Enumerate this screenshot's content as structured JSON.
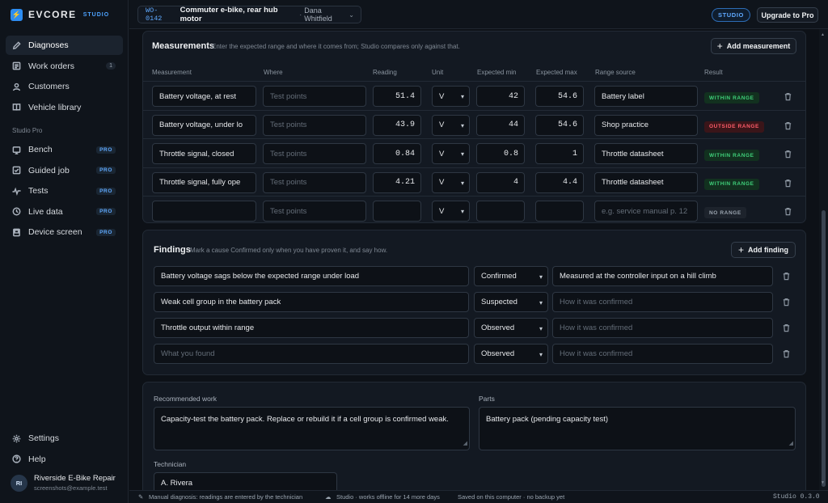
{
  "app": {
    "brand": "EVCORE",
    "brand_sub": "STUDIO",
    "studio_badge": "STUDIO",
    "upgrade_label": "Upgrade to Pro"
  },
  "work_order": {
    "id": "WO-0142",
    "title": "Commuter e-bike, rear hub motor",
    "separator": "·",
    "customer": "Dana Whitfield"
  },
  "sidebar": {
    "items": [
      {
        "label": "Diagnoses",
        "icon": "pencil-icon",
        "active": true
      },
      {
        "label": "Work orders",
        "icon": "list-icon",
        "count": "1"
      },
      {
        "label": "Customers",
        "icon": "person-icon"
      },
      {
        "label": "Vehicle library",
        "icon": "book-icon"
      }
    ],
    "section_label": "Studio Pro",
    "pro_items": [
      {
        "label": "Bench",
        "icon": "gauge-icon",
        "tag": "PRO"
      },
      {
        "label": "Guided job",
        "icon": "checklist-icon",
        "tag": "PRO"
      },
      {
        "label": "Tests",
        "icon": "pulse-icon",
        "tag": "PRO"
      },
      {
        "label": "Live data",
        "icon": "clock-icon",
        "tag": "PRO"
      },
      {
        "label": "Device screen",
        "icon": "device-icon",
        "tag": "PRO"
      }
    ],
    "bottom": [
      {
        "label": "Settings",
        "icon": "gear-icon"
      },
      {
        "label": "Help",
        "icon": "help-icon"
      }
    ],
    "user": {
      "initials": "RI",
      "name": "Riverside E-Bike Repair",
      "email": "screenshots@example.test"
    }
  },
  "measurements": {
    "title": "Measurements",
    "hint": "Enter the expected range and where it comes from; Studio compares only against that.",
    "add_label": "Add measurement",
    "columns": [
      "Measurement",
      "Where",
      "Reading",
      "Unit",
      "Expected min",
      "Expected max",
      "Range source",
      "Result"
    ],
    "rows": [
      {
        "name": "Battery voltage, at rest",
        "where": "Test points",
        "reading": "51.4",
        "unit": "V",
        "min": "42",
        "max": "54.6",
        "source": "Battery label",
        "result": "WITHIN RANGE",
        "status": "in"
      },
      {
        "name": "Battery voltage, under lo",
        "where": "Test points",
        "reading": "43.9",
        "unit": "V",
        "min": "44",
        "max": "54.6",
        "source": "Shop practice",
        "result": "OUTSIDE RANGE",
        "status": "out"
      },
      {
        "name": "Throttle signal, closed",
        "where": "Test points",
        "reading": "0.84",
        "unit": "V",
        "min": "0.8",
        "max": "1",
        "source": "Throttle datasheet",
        "result": "WITHIN RANGE",
        "status": "in"
      },
      {
        "name": "Throttle signal, fully ope",
        "where": "Test points",
        "reading": "4.21",
        "unit": "V",
        "min": "4",
        "max": "4.4",
        "source": "Throttle datasheet",
        "result": "WITHIN RANGE",
        "status": "in"
      },
      {
        "name": "",
        "where": "Test points",
        "reading": "",
        "unit": "V",
        "min": "",
        "max": "",
        "source": "e.g. service manual p. 12",
        "result": "NO RANGE",
        "status": "none"
      }
    ]
  },
  "findings": {
    "title": "Findings",
    "hint": "Mark a cause Confirmed only when you have proven it, and say how.",
    "add_label": "Add finding",
    "rows": [
      {
        "text": "Battery voltage sags below the expected range under load",
        "status": "Confirmed",
        "how": "Measured at the controller input on a hill climb",
        "how_placeholder": false
      },
      {
        "text": "Weak cell group in the battery pack",
        "status": "Suspected",
        "how": "How it was confirmed",
        "how_placeholder": true
      },
      {
        "text": "Throttle output within range",
        "status": "Observed",
        "how": "How it was confirmed",
        "how_placeholder": true
      },
      {
        "text": "What you found",
        "text_placeholder": true,
        "status": "Observed",
        "how": "How it was confirmed",
        "how_placeholder": true
      }
    ]
  },
  "recommendation": {
    "work_label": "Recommended work",
    "work_value": "Capacity-test the battery pack. Replace or rebuild it if a cell group is confirmed weak.",
    "parts_label": "Parts",
    "parts_value": "Battery pack (pending capacity test)",
    "technician_label": "Technician",
    "technician_value": "A. Rivera"
  },
  "footer": {
    "mode": "Manual diagnosis: readings are entered by the technician",
    "offline": "Studio · works offline for 14 more days",
    "saved": "Saved on this computer · no backup yet",
    "version": "Studio 0.3.0"
  },
  "colors": {
    "accent": "#2d8cf0",
    "within": "#3fd07a",
    "outside": "#ff5c69"
  }
}
